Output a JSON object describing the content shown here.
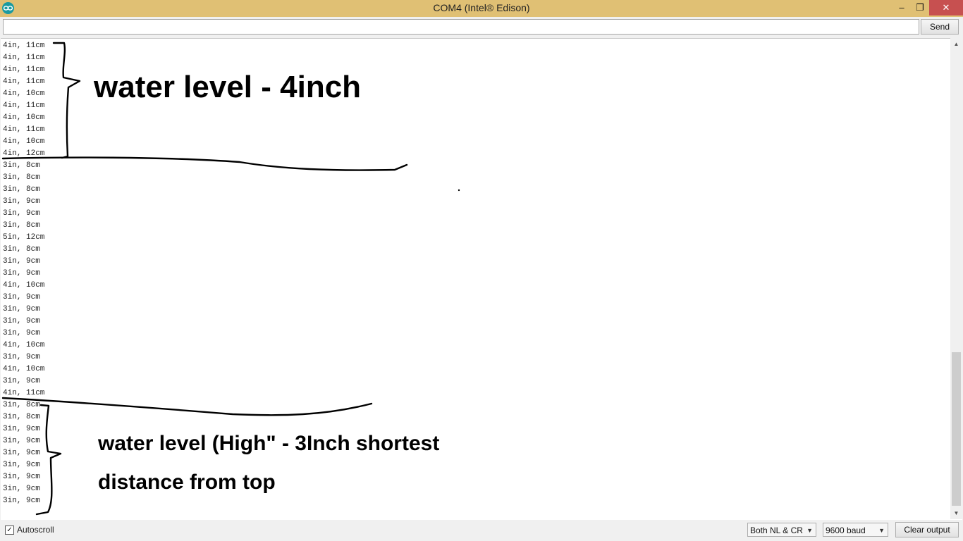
{
  "window": {
    "title": "COM4 (Intel® Edison)",
    "icon": "arduino-icon",
    "controls": {
      "minimize": "–",
      "maximize": "❐",
      "close": "✕"
    }
  },
  "input": {
    "value": "",
    "send_label": "Send"
  },
  "output": {
    "lines": [
      "4in, 11cm",
      "4in, 11cm",
      "4in, 11cm",
      "4in, 11cm",
      "4in, 10cm",
      "4in, 11cm",
      "4in, 10cm",
      "4in, 11cm",
      "4in, 10cm",
      "4in, 12cm",
      "3in, 8cm",
      "3in, 8cm",
      "3in, 8cm",
      "3in, 9cm",
      "3in, 9cm",
      "3in, 8cm",
      "5in, 12cm",
      "3in, 8cm",
      "3in, 9cm",
      "3in, 9cm",
      "4in, 10cm",
      "3in, 9cm",
      "3in, 9cm",
      "3in, 9cm",
      "3in, 9cm",
      "4in, 10cm",
      "3in, 9cm",
      "4in, 10cm",
      "3in, 9cm",
      "4in, 11cm",
      "3in, 8cm",
      "3in, 8cm",
      "3in, 9cm",
      "3in, 9cm",
      "3in, 9cm",
      "3in, 9cm",
      "3in, 9cm",
      "3in, 9cm",
      "3in, 9cm"
    ]
  },
  "annotations": {
    "note_1": "water level - 4inch",
    "note_2": "water level (High\" - 3Inch shortest",
    "note_3": "distance from top"
  },
  "footer": {
    "autoscroll_label": "Autoscroll",
    "autoscroll_checked": true,
    "line_ending": "Both NL & CR",
    "baud_rate": "9600 baud",
    "clear_label": "Clear output"
  },
  "colors": {
    "titlebar": "#e0c074",
    "close_button": "#c75050"
  }
}
